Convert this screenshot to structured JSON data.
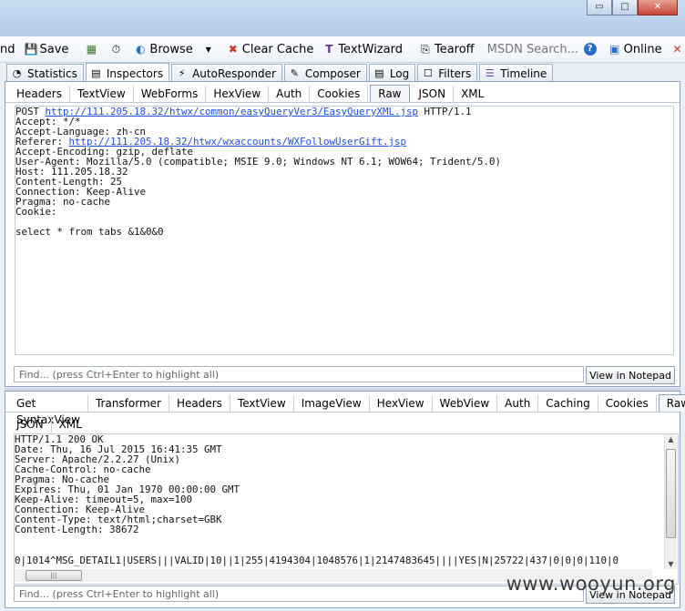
{
  "titlebar": {
    "partial_title": "",
    "buttons": [
      "▭",
      "□",
      "✕"
    ]
  },
  "toolbar": {
    "items": [
      {
        "icon": "",
        "label": "nd"
      },
      {
        "icon": "💾",
        "label": "Save",
        "name": "save-icon"
      },
      {
        "icon": "▦",
        "label": "",
        "name": "snapshot-icon"
      },
      {
        "icon": "⏱",
        "label": "",
        "name": "timer-icon"
      },
      {
        "icon": "◐",
        "label": "Browse",
        "name": "browse-icon"
      },
      {
        "icon": "▾",
        "label": "",
        "name": "dropdown-icon"
      },
      {
        "icon": "✖",
        "label": "Clear Cache",
        "name": "clear-cache-icon"
      },
      {
        "icon": "T",
        "label": "TextWizard",
        "name": "textwizard-icon"
      },
      {
        "icon": "⎘",
        "label": "Tearoff",
        "name": "tearoff-icon"
      }
    ],
    "msdn_placeholder": "MSDN Search...",
    "help_icon": "?",
    "online_label": "Online",
    "close_glyph": "✕"
  },
  "main_tabs": [
    {
      "label": "Statistics",
      "icon": "◔"
    },
    {
      "label": "Inspectors",
      "icon": "▤"
    },
    {
      "label": "AutoResponder",
      "icon": "⚡"
    },
    {
      "label": "Composer",
      "icon": "✎"
    },
    {
      "label": "Log",
      "icon": "▤"
    },
    {
      "label": "Filters",
      "icon": "☐"
    },
    {
      "label": "Timeline",
      "icon": "☰"
    }
  ],
  "request": {
    "tabs": [
      "Headers",
      "TextView",
      "WebForms",
      "HexView",
      "Auth",
      "Cookies",
      "Raw",
      "JSON",
      "XML"
    ],
    "active_tab": "Raw",
    "line1_method": "POST ",
    "line1_url": "http://111.205.18.32/htwx/common/easyQueryVer3/EasyQueryXML.jsp",
    "line1_proto": " HTTP/1.1",
    "line2": "Accept: */*",
    "line3": "Accept-Language: zh-cn",
    "line4_label": "Referer: ",
    "line4_url": "http://111.205.18.32/htwx/wxaccounts/WXFollowUserGift.jsp",
    "line5": "Accept-Encoding: gzip, deflate",
    "line6": "User-Agent: Mozilla/5.0 (compatible; MSIE 9.0; Windows NT 6.1; WOW64; Trident/5.0)",
    "line7": "Host: 111.205.18.32",
    "line8": "Content-Length: 25",
    "line9": "Connection: Keep-Alive",
    "line10": "Pragma: no-cache",
    "line11": "Cookie:",
    "line12": "",
    "line13": "select * from tabs &1&0&0",
    "find_placeholder": "Find... (press Ctrl+Enter to highlight all)",
    "notepad_button": "View in Notepad"
  },
  "response": {
    "tabs_row1": [
      "Get SyntaxView",
      "Transformer",
      "Headers",
      "TextView",
      "ImageView",
      "HexView",
      "WebView",
      "Auth",
      "Caching",
      "Cookies",
      "Raw"
    ],
    "tabs_row2": [
      "JSON",
      "XML"
    ],
    "active_tab": "Raw",
    "lines": [
      "HTTP/1.1 200 OK",
      "Date: Thu, 16 Jul 2015 16:41:35 GMT",
      "Server: Apache/2.2.27 (Unix)",
      "Cache-Control: no-cache",
      "Pragma: No-cache",
      "Expires: Thu, 01 Jan 1970 00:00:00 GMT",
      "Keep-Alive: timeout=5, max=100",
      "Connection: Keep-Alive",
      "Content-Type: text/html;charset=GBK",
      "Content-Length: 38672"
    ],
    "body_line": "0|1014^MSG_DETAIL1|USERS|||VALID|10||1|255|4194304|1048576|1|2147483645||||YES|N|25722|437|0|0|0|110|0",
    "find_placeholder": "Find... (press Ctrl+Enter to highlight all)",
    "notepad_button": "View in Notepad"
  },
  "watermark": "www.wooyun.org"
}
